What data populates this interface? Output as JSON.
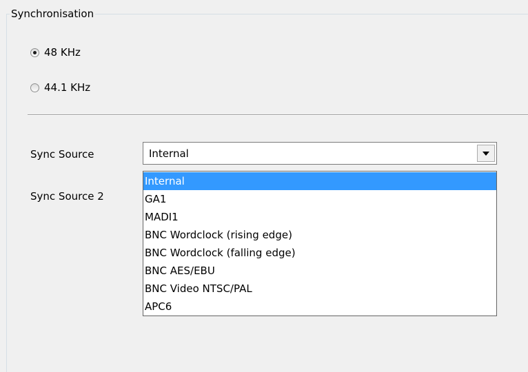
{
  "group": {
    "title": "Synchronisation"
  },
  "sample_rate": {
    "options": [
      {
        "label": "48 KHz",
        "checked": true
      },
      {
        "label": "44.1 KHz",
        "checked": false
      }
    ]
  },
  "sync_source": {
    "label": "Sync Source",
    "value": "Internal"
  },
  "sync_source_2": {
    "label": "Sync Source 2"
  },
  "dropdown": {
    "selected_index": 0,
    "items": [
      "Internal",
      "GA1",
      "MADI1",
      "BNC Wordclock (rising edge)",
      "BNC Wordclock (falling edge)",
      "BNC AES/EBU",
      "BNC Video NTSC/PAL",
      "APC6"
    ]
  },
  "colors": {
    "highlight": "#3399ff",
    "background": "#f0f0f0"
  },
  "icons": {
    "combo_arrow": "chevron-down-icon"
  }
}
